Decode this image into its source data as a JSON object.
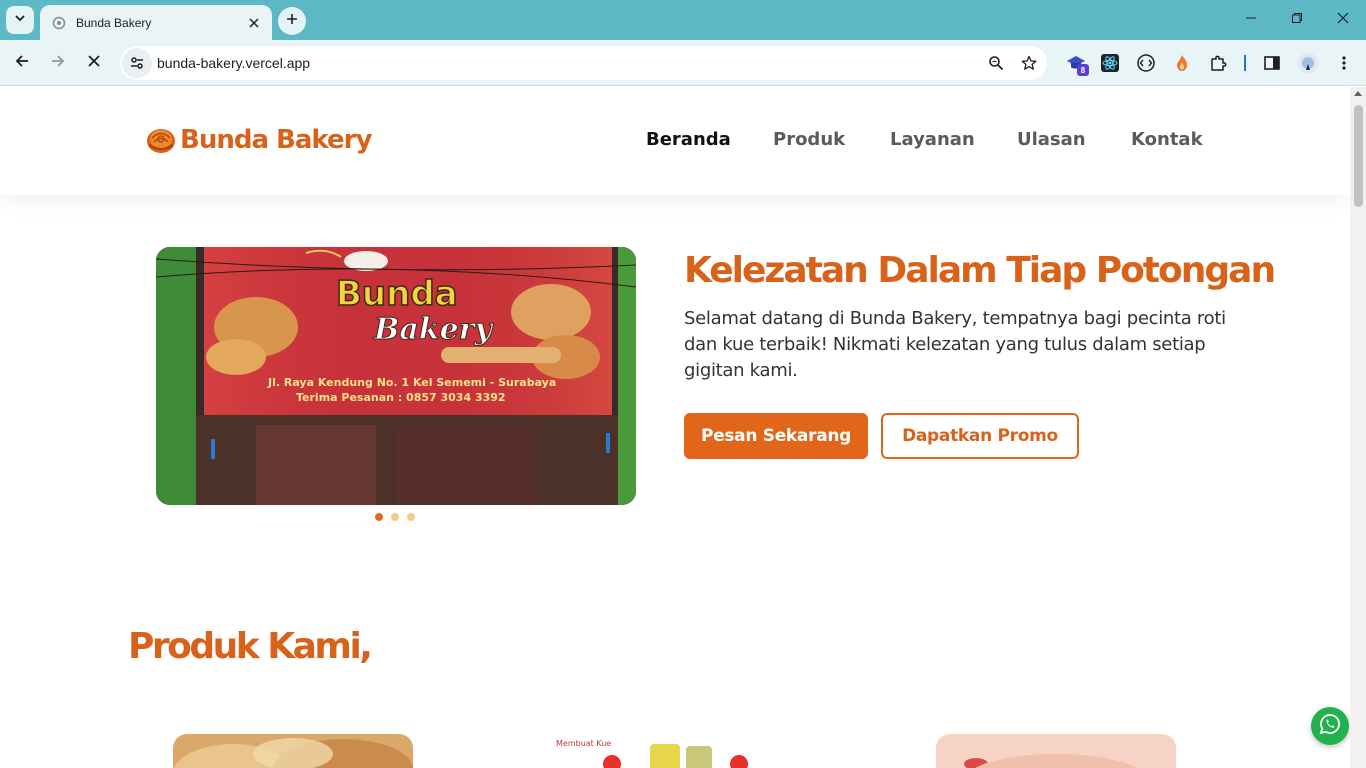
{
  "browser": {
    "tab_title": "Bunda Bakery",
    "url": "bunda-bakery.vercel.app",
    "extension_badge": "8"
  },
  "site": {
    "brand_name": "Bunda Bakery",
    "nav": [
      "Beranda",
      "Produk",
      "Layanan",
      "Ulasan",
      "Kontak"
    ],
    "active_nav": "Beranda",
    "hero": {
      "title": "Kelezatan Dalam Tiap Potongan",
      "text": "Selamat datang di Bunda Bakery, tempatnya bagi pecinta roti dan kue terbaik! Nikmati kelezatan yang tulus dalam setiap gigitan kami.",
      "primary_button": "Pesan Sekarang",
      "secondary_button": "Dapatkan Promo",
      "slide_count": 3,
      "active_slide": 1,
      "banner": {
        "line1": "Bunda",
        "line2": "Bakery",
        "address": "Jl. Raya Kendung No. 1 Kel Sememi - Surabaya",
        "phone": "Terima Pesanan : 0857 3034 3392"
      }
    },
    "products_title": "Produk Kami,",
    "product_image_text": "Membuat Kue"
  },
  "colors": {
    "accent": "#e2661a",
    "browser_frame": "#5cb8c4",
    "whatsapp": "#22b24c"
  }
}
